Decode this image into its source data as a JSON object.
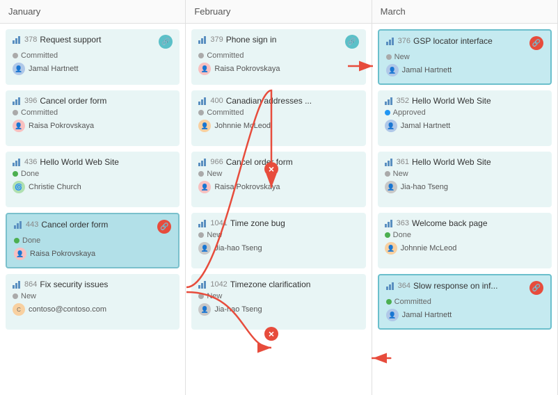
{
  "columns": [
    {
      "id": "january",
      "label": "January",
      "cards": [
        {
          "id": "378",
          "name": "Request support",
          "status": "Committed",
          "status_type": "committed",
          "user": "Jamal Hartnett",
          "avatar": "blue",
          "highlighted": false,
          "link": false
        },
        {
          "id": "396",
          "name": "Cancel order form",
          "status": "Committed",
          "status_type": "committed",
          "user": "Raisa Pokrovskaya",
          "avatar": "pink",
          "highlighted": false,
          "link": false
        },
        {
          "id": "436",
          "name": "Hello World Web Site",
          "status": "Done",
          "status_type": "done",
          "user": "Christie Church",
          "avatar": "green",
          "highlighted": false,
          "link": false
        },
        {
          "id": "443",
          "name": "Cancel order form",
          "status": "Done",
          "status_type": "done",
          "user": "Raisa Pokrovskaya",
          "avatar": "pink",
          "highlighted": true,
          "link": true
        },
        {
          "id": "864",
          "name": "Fix security issues",
          "status": "New",
          "status_type": "new",
          "user": "contoso@contoso.com",
          "avatar": "orange",
          "highlighted": false,
          "link": false
        }
      ]
    },
    {
      "id": "february",
      "label": "February",
      "cards": [
        {
          "id": "379",
          "name": "Phone sign in",
          "status": "Committed",
          "status_type": "committed",
          "user": "Raisa Pokrovskaya",
          "avatar": "pink",
          "highlighted": false,
          "link": true
        },
        {
          "id": "400",
          "name": "Canadian addresses ...",
          "status": "Committed",
          "status_type": "committed",
          "user": "Johnnie McLeod",
          "avatar": "orange",
          "highlighted": false,
          "link": false
        },
        {
          "id": "966",
          "name": "Cancel order form",
          "status": "New",
          "status_type": "new",
          "user": "Raisa Pokrovskaya",
          "avatar": "pink",
          "highlighted": false,
          "link": false
        },
        {
          "id": "1041",
          "name": "Time zone bug",
          "status": "New",
          "status_type": "new",
          "user": "Jia-hao Tseng",
          "avatar": "gray",
          "highlighted": false,
          "link": false
        },
        {
          "id": "1042",
          "name": "Timezone clarification",
          "status": "New",
          "status_type": "new",
          "user": "Jia-hao Tseng",
          "avatar": "gray",
          "highlighted": false,
          "link": false
        }
      ]
    },
    {
      "id": "march",
      "label": "March",
      "cards": [
        {
          "id": "376",
          "name": "GSP locator interface",
          "status": "New",
          "status_type": "new",
          "user": "Jamal Hartnett",
          "avatar": "blue",
          "highlighted": true,
          "link": true
        },
        {
          "id": "352",
          "name": "Hello World Web Site",
          "status": "Approved",
          "status_type": "approved",
          "user": "Jamal Hartnett",
          "avatar": "blue",
          "highlighted": false,
          "link": false
        },
        {
          "id": "361",
          "name": "Hello World Web Site",
          "status": "New",
          "status_type": "new",
          "user": "Jia-hao Tseng",
          "avatar": "gray",
          "highlighted": false,
          "link": false
        },
        {
          "id": "363",
          "name": "Welcome back page",
          "status": "Done",
          "status_type": "done",
          "user": "Johnnie McLeod",
          "avatar": "orange",
          "highlighted": false,
          "link": false
        },
        {
          "id": "364",
          "name": "Slow response on inf...",
          "status": "Committed",
          "status_type": "committed",
          "user": "Jamal Hartnett",
          "avatar": "blue",
          "highlighted": true,
          "link": true
        }
      ]
    }
  ]
}
